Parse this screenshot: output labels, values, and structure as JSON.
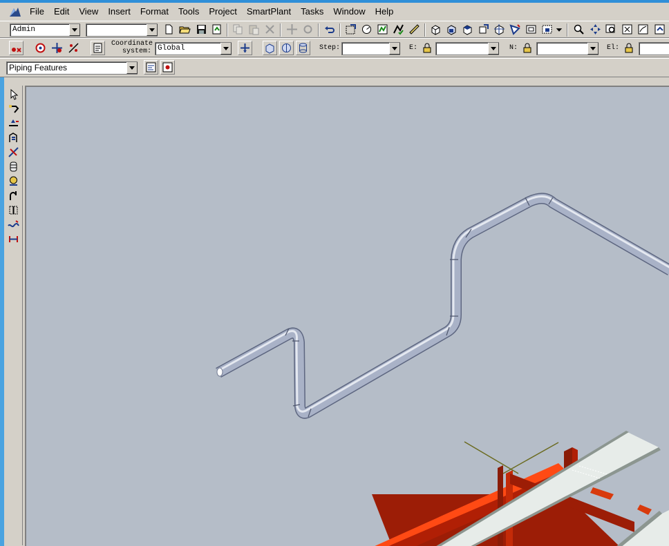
{
  "menu": {
    "items": [
      "File",
      "Edit",
      "View",
      "Insert",
      "Format",
      "Tools",
      "Project",
      "SmartPlant",
      "Tasks",
      "Window",
      "Help"
    ]
  },
  "toolbar1": {
    "permission_group": "Admin",
    "filter_combo": ""
  },
  "toolbar2": {
    "coordinate_label_line1": "Coordinate",
    "coordinate_label_line2": "system:",
    "coordinate_value": "Global",
    "step_label": "Step:",
    "step_value": "",
    "e_label": "E:",
    "e_value": "",
    "n_label": "N:",
    "n_value": "",
    "el_label": "El:",
    "el_value": ""
  },
  "toolbar3": {
    "feature_combo": "Piping Features"
  },
  "colors": {
    "viewport_bg": "#b5bdc8",
    "pipe": "#a9b2c7",
    "steel_red": "#b01f05",
    "steel_orange": "#ff4a14",
    "tray": "#e7ece9",
    "axis": "#6b6b20"
  }
}
